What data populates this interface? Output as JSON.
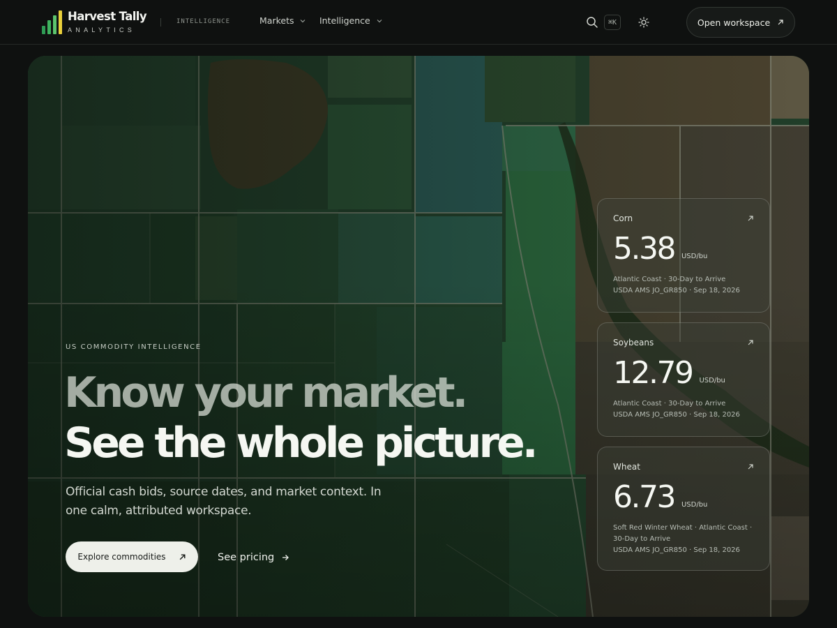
{
  "brand": {
    "name": "Harvest Tally",
    "subtitle": "ANALYTICS",
    "tag": "INTELLIGENCE",
    "bar_colors": [
      "#2f9a54",
      "#3fb35f",
      "#5cc46d",
      "#e9cf3a"
    ]
  },
  "nav": {
    "items": [
      {
        "label": "Markets",
        "icon": "chevron-down-icon"
      },
      {
        "label": "Intelligence",
        "icon": "chevron-down-icon"
      }
    ],
    "search_icon": "search-icon",
    "shortcut": "⌘K",
    "theme_icon": "sun-icon",
    "workspace_label": "Open workspace"
  },
  "hero": {
    "eyebrow": "US COMMODITY INTELLIGENCE",
    "headline_line1": "Know your market.",
    "headline_line2": "See the whole picture.",
    "lede": "Official cash bids, source dates, and market context. In one calm, attributed workspace.",
    "cta_primary": "Explore commodities",
    "cta_secondary": "See pricing"
  },
  "cards": [
    {
      "name": "Corn",
      "price": "5.38",
      "unit": "USD/bu",
      "meta": [
        "Atlantic Coast · 30-Day to Arrive",
        "USDA AMS JO_GR850 · Sep 18, 2026"
      ]
    },
    {
      "name": "Soybeans",
      "price": "12.79",
      "unit": "USD/bu",
      "meta": [
        "Atlantic Coast · 30-Day to Arrive",
        "USDA AMS JO_GR850 · Sep 18, 2026"
      ]
    },
    {
      "name": "Wheat",
      "price": "6.73",
      "unit": "USD/bu",
      "meta": [
        "Soft Red Winter Wheat · Atlantic Coast ·",
        "30-Day to Arrive",
        "USDA AMS JO_GR850 · Sep 18, 2026"
      ]
    }
  ],
  "colors": {
    "background": "#0f1110",
    "accent_yellow": "#e9cf3a",
    "accent_green": "#3fb35f",
    "button_light": "#eef0ea"
  }
}
